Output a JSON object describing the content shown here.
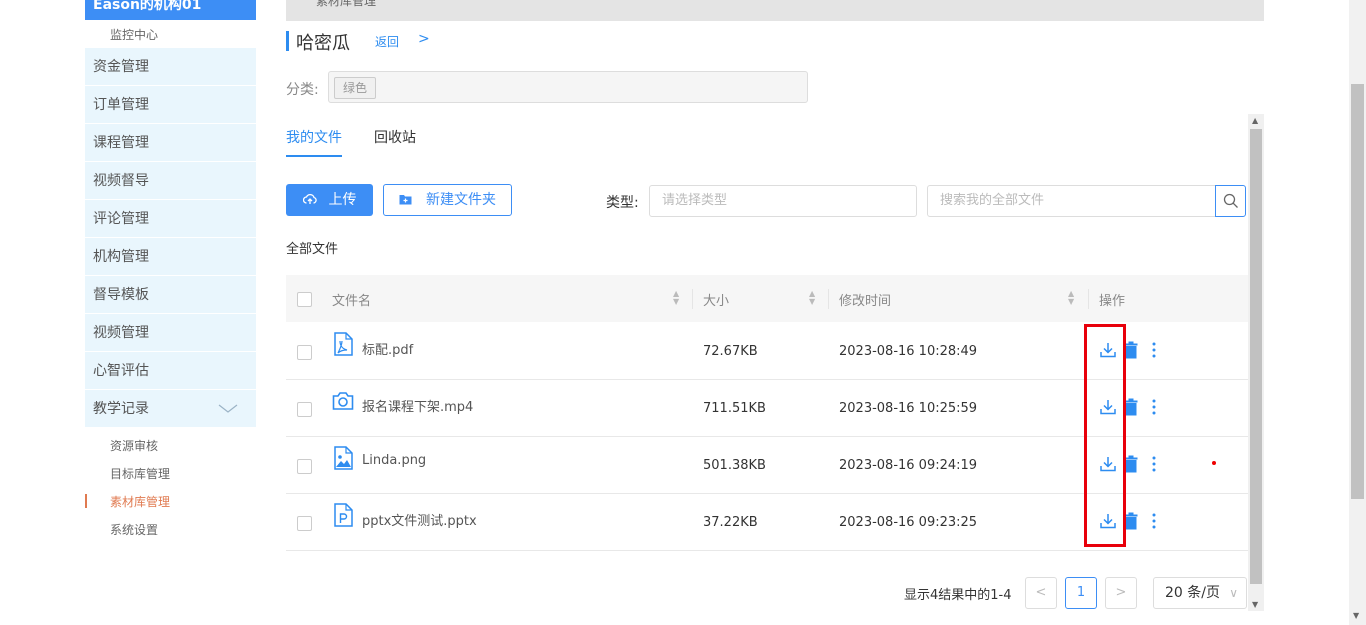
{
  "sidebar": {
    "brand": "Eason的机构01",
    "top_sub": "监控中心",
    "menu": [
      "资金管理",
      "订单管理",
      "课程管理",
      "视频督导",
      "评论管理",
      "机构管理",
      "督导模板",
      "视频管理",
      "心智评估",
      "教学记录"
    ],
    "sub_items": [
      "资源审核",
      "目标库管理",
      "素材库管理",
      "系统设置"
    ]
  },
  "topbar": {
    "crumb": "素材库管理"
  },
  "header": {
    "title": "哈密瓜",
    "back": "返回",
    "back_arrow": ">"
  },
  "category": {
    "label": "分类:",
    "tag": "绿色"
  },
  "tabs": [
    "我的文件",
    "回收站"
  ],
  "toolbar": {
    "upload": "上传",
    "new_folder": "新建文件夹",
    "type_label": "类型:",
    "type_placeholder": "请选择类型",
    "search_placeholder": "搜索我的全部文件"
  },
  "section_title": "全部文件",
  "table": {
    "headers": {
      "name": "文件名",
      "size": "大小",
      "time": "修改时间",
      "action": "操作"
    },
    "rows": [
      {
        "name": "标配.pdf",
        "size": "72.67KB",
        "time": "2023-08-16 10:28:49",
        "icon": "pdf-icon"
      },
      {
        "name": "报名课程下架.mp4",
        "size": "711.51KB",
        "time": "2023-08-16 10:25:59",
        "icon": "video-icon"
      },
      {
        "name": "Linda.png",
        "size": "501.38KB",
        "time": "2023-08-16 09:24:19",
        "icon": "image-icon"
      },
      {
        "name": "pptx文件测试.pptx",
        "size": "37.22KB",
        "time": "2023-08-16 09:23:25",
        "icon": "ppt-icon"
      }
    ]
  },
  "pagination": {
    "info": "显示4结果中的1-4",
    "current": "1",
    "page_size": "20 条/页",
    "prev": "<",
    "next": ">"
  },
  "colors": {
    "accent": "#3d8ef5",
    "highlight": "#e8000b",
    "active_sub": "#e07a50"
  }
}
